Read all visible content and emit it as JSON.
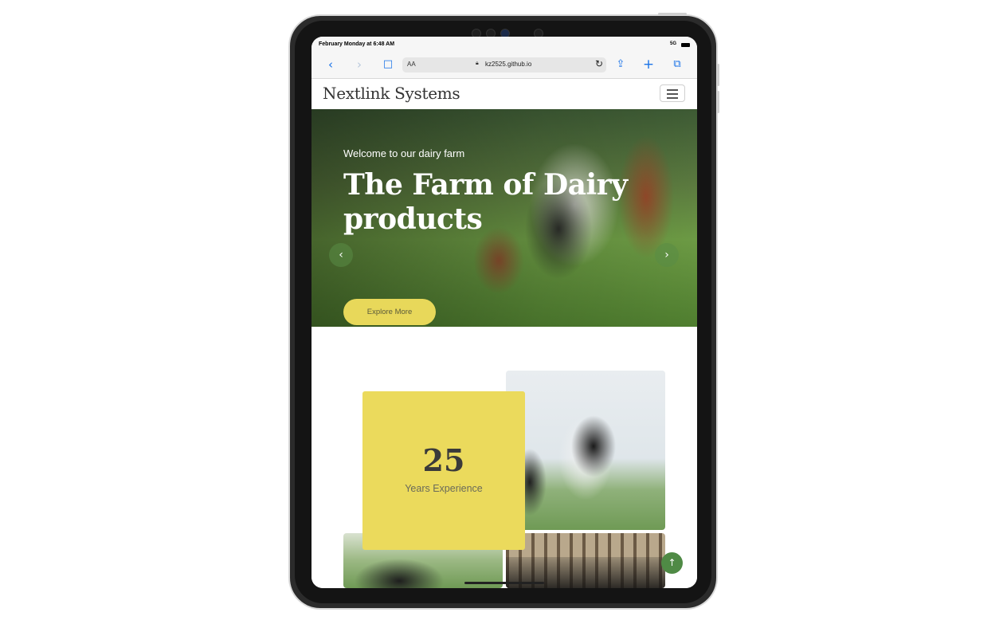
{
  "statusbar": {
    "time": "February Monday at 6:48 AM",
    "network": "5G"
  },
  "browser": {
    "aa_label": "AA",
    "url": "kz2525.github.io",
    "icons": [
      "back-icon",
      "forward-icon",
      "bookmarks-icon",
      "lock-icon",
      "reload-icon",
      "share-icon",
      "new-tab-icon",
      "tabs-icon"
    ]
  },
  "navbar": {
    "brand": "Nextlink Systems"
  },
  "hero": {
    "subtitle": "Welcome to our dairy farm",
    "title": "The Farm of Dairy products",
    "button_label": "Explore More"
  },
  "about": {
    "experience_number": "25",
    "experience_label": "Years Experience"
  },
  "colors": {
    "accent_yellow": "#ebda5c",
    "accent_green": "#4f8a45",
    "link_blue": "#1a73e8"
  }
}
